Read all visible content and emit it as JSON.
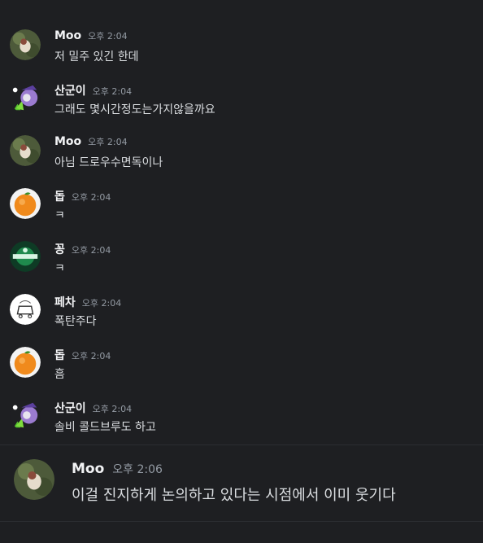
{
  "messages": [
    {
      "author": "Moo",
      "time": "오후 2:04",
      "text": "저 밀주 있긴 한데",
      "avatar": "moo-avatar"
    },
    {
      "author": "산군이",
      "time": "오후 2:04",
      "text": "그래도 몇시간정도는가지않을까요",
      "avatar": "sangun-avatar"
    },
    {
      "author": "Moo",
      "time": "오후 2:04",
      "text": "아님 드로우수면독이나",
      "avatar": "moo-avatar"
    },
    {
      "author": "돕",
      "time": "오후 2:04",
      "text": "ㅋ",
      "avatar": "orange-avatar"
    },
    {
      "author": "꽁",
      "time": "오후 2:04",
      "text": "ㅋ",
      "avatar": "green-logo-avatar"
    },
    {
      "author": "페차",
      "time": "오후 2:04",
      "text": "폭탄주다",
      "avatar": "sketch-avatar"
    },
    {
      "author": "돕",
      "time": "오후 2:04",
      "text": "흠",
      "avatar": "orange-avatar"
    },
    {
      "author": "산군이",
      "time": "오후 2:04",
      "text": "솔비 콜드브루도 하고",
      "avatar": "sangun-avatar"
    }
  ],
  "highlight": {
    "author": "Moo",
    "time": "오후 2:06",
    "text": "이걸 진지하게 논의하고 있다는 시점에서 이미 웃기다",
    "avatar": "moo-avatar"
  },
  "colors": {
    "background": "#1e1f22",
    "name": "#f2f3f5",
    "text": "#dbdee1",
    "timestamp": "#949ba4"
  }
}
